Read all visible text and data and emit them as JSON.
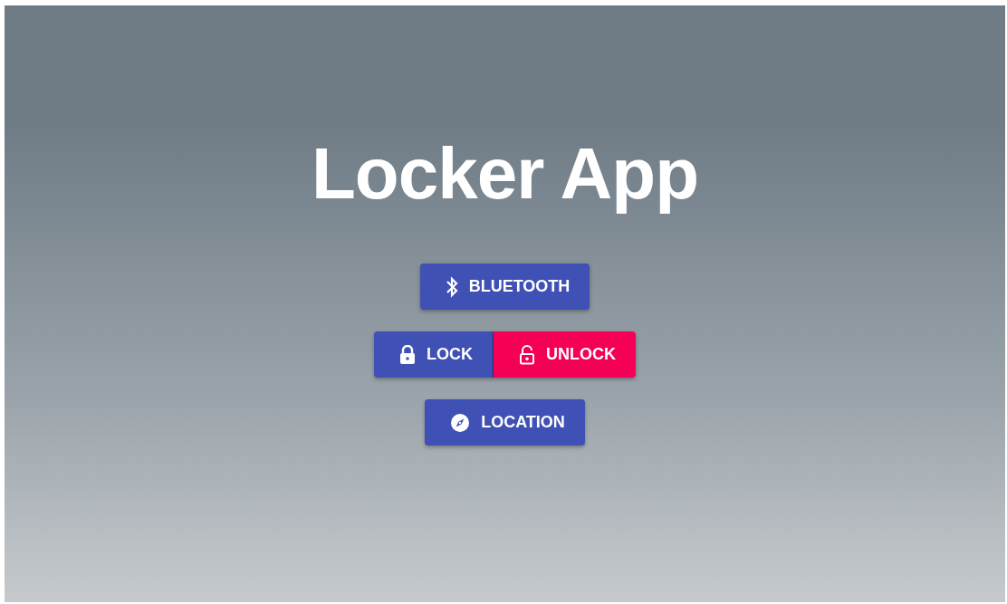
{
  "title": "Locker App",
  "rows": [
    [
      {
        "kind": "bluetooth",
        "label": "BLUETOOTH",
        "color": "#3f51b5"
      }
    ],
    [
      {
        "kind": "lock",
        "label": "LOCK",
        "color": "#3f51b5"
      },
      {
        "kind": "unlock",
        "label": "UNLOCK",
        "color": "#f50057"
      }
    ],
    [
      {
        "kind": "location",
        "label": "LOCATION",
        "color": "#3f51b5"
      }
    ]
  ]
}
